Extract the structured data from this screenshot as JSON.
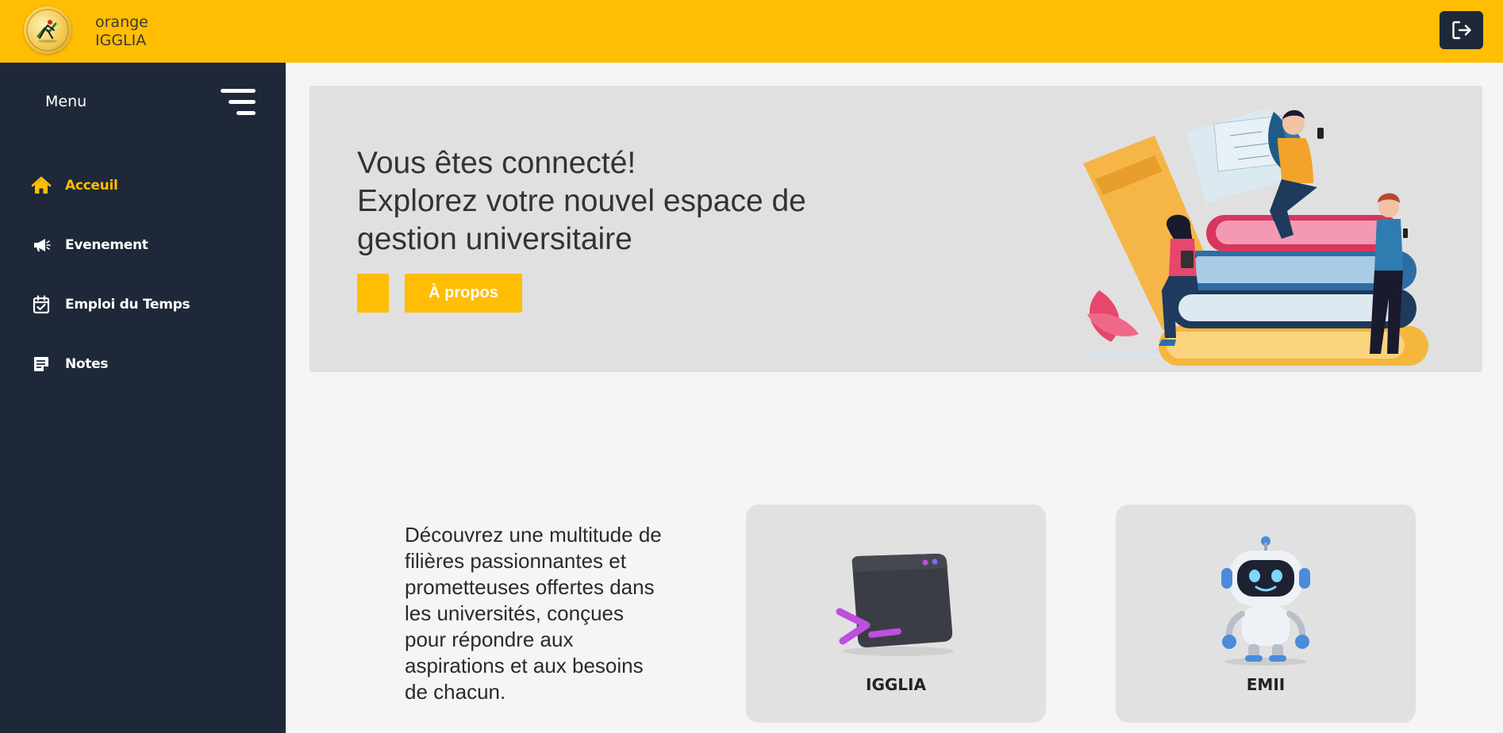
{
  "header": {
    "brand_line1": "orange",
    "brand_line2": "IGGLIA",
    "logout_icon": "logout-icon",
    "bg_color": "#ffbd03"
  },
  "sidebar": {
    "menu_label": "Menu",
    "items": [
      {
        "label": "Acceuil",
        "icon": "home-icon",
        "active": true
      },
      {
        "label": "Evenement",
        "icon": "megaphone-icon",
        "active": false
      },
      {
        "label": "Emploi du Temps",
        "icon": "calendar-check-icon",
        "active": false
      },
      {
        "label": "Notes",
        "icon": "note-icon",
        "active": false
      }
    ],
    "bg_color": "#1e2838",
    "active_color": "#ffbd03"
  },
  "hero": {
    "title_lines": [
      "Vous êtes connecté!",
      "Explorez votre nouvel espace de",
      "gestion universitaire"
    ],
    "button_label": "À propos"
  },
  "discover": {
    "text": "Découvrez une multitude de filières passionnantes et prometteuses offertes dans les universités, conçues pour répondre aux aspirations et aux besoins de chacun."
  },
  "cards": [
    {
      "label": "IGGLIA",
      "icon": "terminal-icon"
    },
    {
      "label": "EMII",
      "icon": "robot-icon"
    }
  ]
}
